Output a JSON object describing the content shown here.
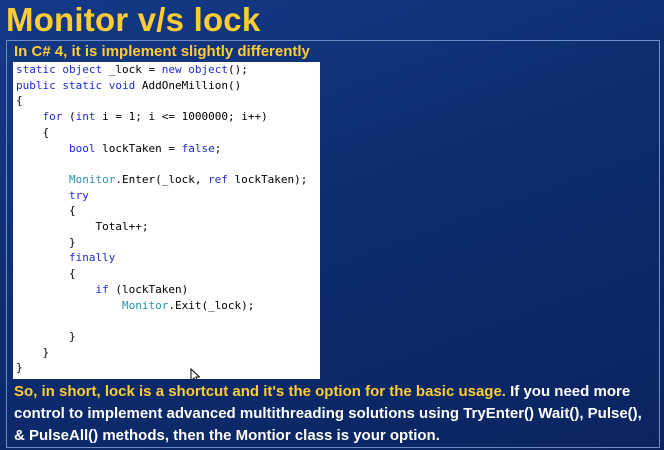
{
  "slide": {
    "title": "Monitor v/s lock",
    "subtitle": "In C# 4, it is implement slightly differently",
    "summary_highlight": "So, in short, lock is a shortcut and it's the option for the basic usage.",
    "summary_rest": " If you need more control to implement advanced multithreading solutions using TryEnter() Wait(), Pulse(), & PulseAll() methods, then the Montior class is your option."
  },
  "code": {
    "lines": [
      "static object _lock = new object();",
      "public static void AddOneMillion()",
      "{",
      "    for (int i = 1; i <= 1000000; i++)",
      "    {",
      "        bool lockTaken = false;",
      "",
      "        Monitor.Enter(_lock, ref lockTaken);",
      "        try",
      "        {",
      "            Total++;",
      "        }",
      "        finally",
      "        {",
      "            if (lockTaken)",
      "                Monitor.Exit(_lock);",
      "",
      "        }",
      "    }",
      "}"
    ]
  },
  "colors": {
    "background": "#0d2d70",
    "title": "#ffcc33",
    "keyword": "#1f2bd4",
    "type": "#2b91af"
  },
  "icons": {
    "cursor": "mouse-pointer-icon"
  }
}
